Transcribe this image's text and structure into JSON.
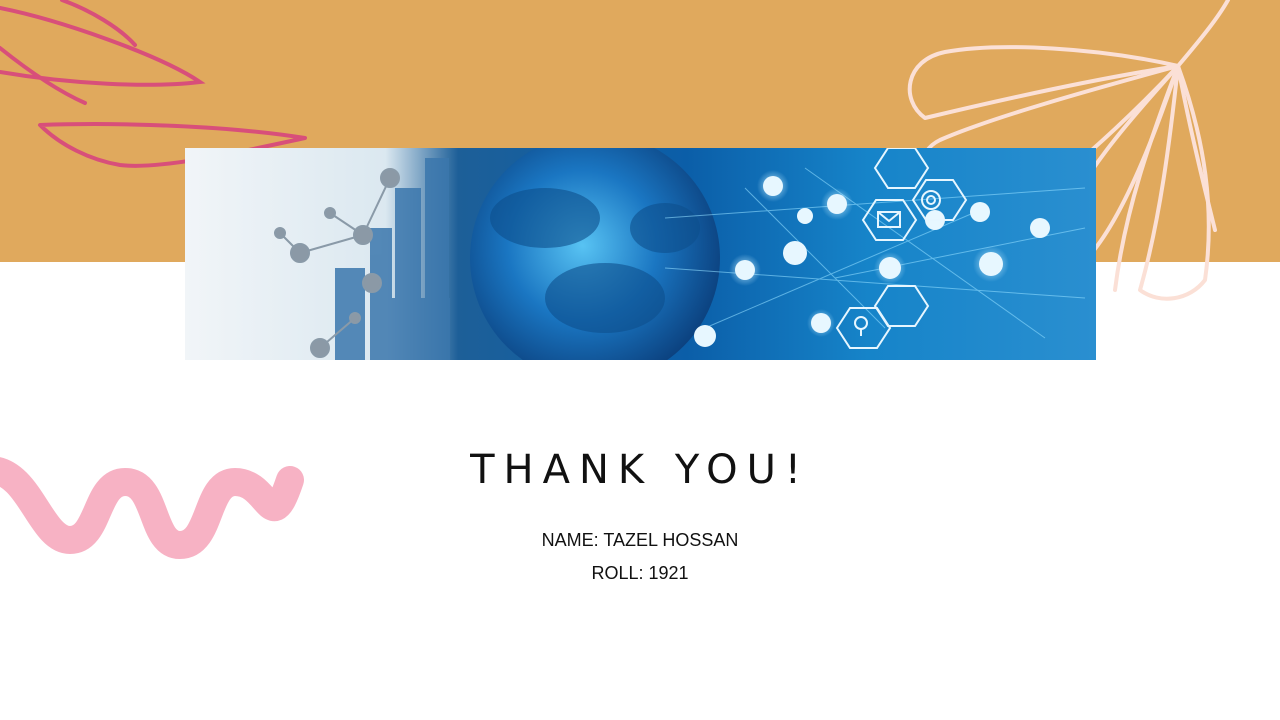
{
  "slide": {
    "title": "THANK YOU!",
    "name_line": "NAME: TAZEL HOSSAN",
    "roll_line": "ROLL: 1921"
  },
  "colors": {
    "top_band": "#e0a95d",
    "leaf_outline": "#d84f7a",
    "flower_outline": "#fbe0d6",
    "squiggle": "#f7b2c4",
    "banner_blue": "#0f6fb8"
  },
  "icons": [
    "leaf-outline-decoration",
    "flower-outline-decoration",
    "pink-squiggle-decoration",
    "network-globe-image"
  ]
}
